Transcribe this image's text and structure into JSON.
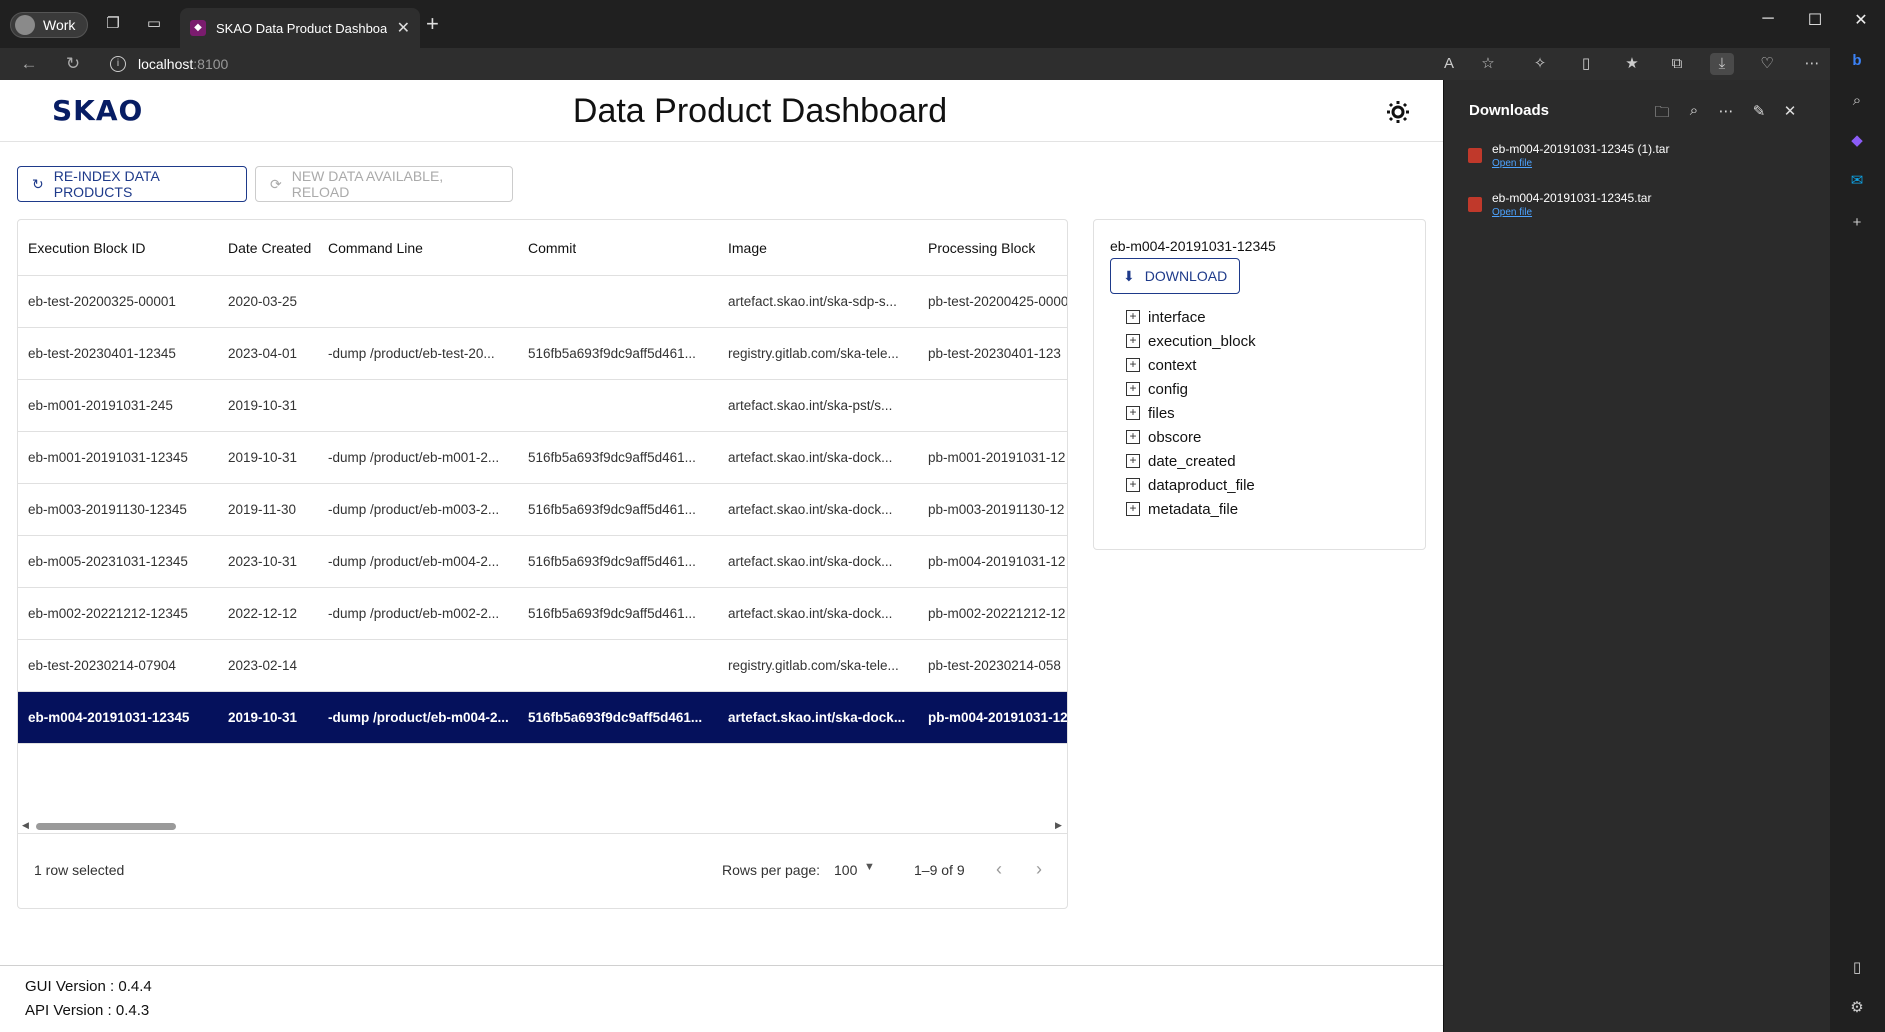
{
  "browser": {
    "profile_label": "Work",
    "tab_title": "SKAO Data Product Dashboard",
    "url_host": "localhost",
    "url_port": ":8100"
  },
  "header": {
    "logo_text": "SKAO",
    "title": "Data Product Dashboard"
  },
  "actions": {
    "reindex_label": "RE-INDEX DATA PRODUCTS",
    "reload_label": "NEW DATA AVAILABLE, RELOAD"
  },
  "grid": {
    "columns": [
      "Execution Block ID",
      "Date Created",
      "Command Line",
      "Commit",
      "Image",
      "Processing Block"
    ],
    "rows": [
      [
        "eb-test-20200325-00001",
        "2020-03-25",
        "",
        "",
        "artefact.skao.int/ska-sdp-s...",
        "pb-test-20200425-0000"
      ],
      [
        "eb-test-20230401-12345",
        "2023-04-01",
        "-dump /product/eb-test-20...",
        "516fb5a693f9dc9aff5d461...",
        "registry.gitlab.com/ska-tele...",
        "pb-test-20230401-123"
      ],
      [
        "eb-m001-20191031-245",
        "2019-10-31",
        "",
        "",
        "artefact.skao.int/ska-pst/s...",
        ""
      ],
      [
        "eb-m001-20191031-12345",
        "2019-10-31",
        "-dump /product/eb-m001-2...",
        "516fb5a693f9dc9aff5d461...",
        "artefact.skao.int/ska-dock...",
        "pb-m001-20191031-12"
      ],
      [
        "eb-m003-20191130-12345",
        "2019-11-30",
        "-dump /product/eb-m003-2...",
        "516fb5a693f9dc9aff5d461...",
        "artefact.skao.int/ska-dock...",
        "pb-m003-20191130-12"
      ],
      [
        "eb-m005-20231031-12345",
        "2023-10-31",
        "-dump /product/eb-m004-2...",
        "516fb5a693f9dc9aff5d461...",
        "artefact.skao.int/ska-dock...",
        "pb-m004-20191031-12"
      ],
      [
        "eb-m002-20221212-12345",
        "2022-12-12",
        "-dump /product/eb-m002-2...",
        "516fb5a693f9dc9aff5d461...",
        "artefact.skao.int/ska-dock...",
        "pb-m002-20221212-12"
      ],
      [
        "eb-test-20230214-07904",
        "2023-02-14",
        "",
        "",
        "registry.gitlab.com/ska-tele...",
        "pb-test-20230214-058"
      ],
      [
        "eb-m004-20191031-12345",
        "2019-10-31",
        "-dump /product/eb-m004-2...",
        "516fb5a693f9dc9aff5d461...",
        "artefact.skao.int/ska-dock...",
        "pb-m004-20191031-12"
      ]
    ],
    "selected_row_index": 8,
    "footer": {
      "selection": "1 row selected",
      "rows_per_page_label": "Rows per page:",
      "rows_per_page_value": "100",
      "range": "1–9 of 9"
    }
  },
  "detail": {
    "title": "eb-m004-20191031-12345",
    "download_label": "DOWNLOAD",
    "tree": [
      "interface",
      "execution_block",
      "context",
      "config",
      "files",
      "obscore",
      "date_created",
      "dataproduct_file",
      "metadata_file"
    ]
  },
  "footer": {
    "gui_version": "GUI Version : 0.4.4",
    "api_version": "API Version : 0.4.3"
  },
  "downloads": {
    "title": "Downloads",
    "items": [
      {
        "name": "eb-m004-20191031-12345 (1).tar",
        "action": "Open file"
      },
      {
        "name": "eb-m004-20191031-12345.tar",
        "action": "Open file"
      }
    ]
  },
  "colors": {
    "brand_navy": "#071d64",
    "brand_magenta": "#e5007d",
    "selected_row": "#05115c"
  }
}
